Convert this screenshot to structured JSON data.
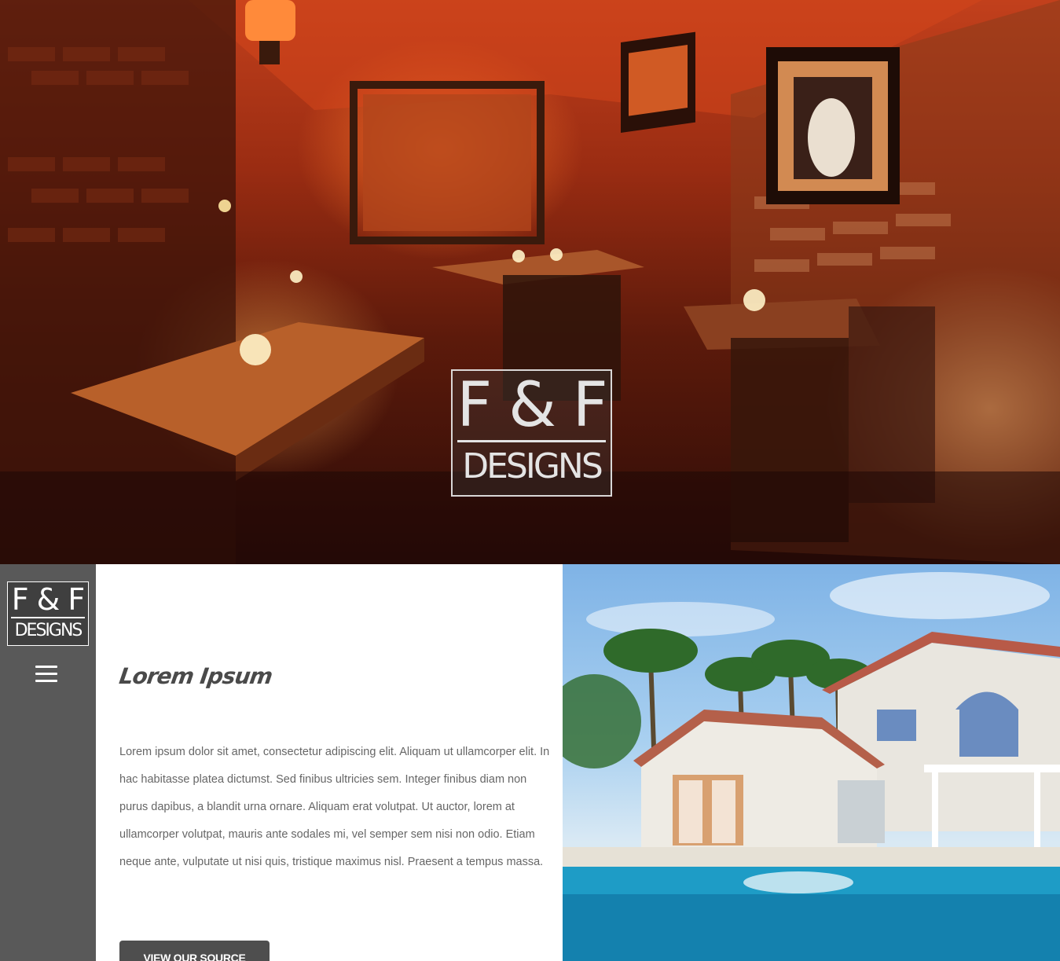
{
  "hero": {
    "logo_top": "F & F",
    "logo_bottom": "DESIGNS",
    "image_description_icon": "restaurant-interior-image"
  },
  "sidebar": {
    "logo_top": "F & F",
    "logo_bottom": "DESIGNS",
    "menu_icon": "hamburger-menu-icon"
  },
  "content": {
    "heading": "Lorem Ipsum",
    "body": "Lorem ipsum dolor sit amet, consectetur adipiscing elit. Aliquam ut ullamcorper elit. In hac habitasse platea dictumst. Sed finibus ultricies sem. Integer finibus diam non purus dapibus, a blandit urna ornare. Aliquam erat volutpat. Ut auctor, lorem at ullamcorper volutpat, mauris ante sodales mi, vel semper sem nisi non odio. Etiam neque ante, vulputate ut nisi quis, tristique maximus nisl. Praesent a tempus massa.",
    "button_label": "VIEW OUR SOURCE"
  },
  "photo": {
    "image_icon": "house-with-pool-image"
  },
  "colors": {
    "sidebar_bg": "#595959",
    "button_bg": "#4e4e4e",
    "heading": "#4a4a4a",
    "body_text": "#666666"
  }
}
